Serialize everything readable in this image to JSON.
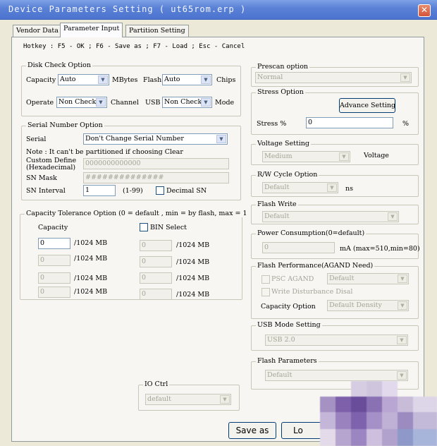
{
  "window": {
    "title": "Device Parameters Setting ( ut65rom.erp )",
    "close_glyph": "✕"
  },
  "tabs": [
    {
      "label": "Vendor Data"
    },
    {
      "label": "Parameter Input"
    },
    {
      "label": "Partition Setting"
    }
  ],
  "hotkey": "Hotkey : F5 - OK ; F6 - Save as ; F7 - Load ; Esc - Cancel",
  "disk_check": {
    "legend": "Disk Check Option",
    "capacity_label": "Capacity",
    "capacity_value": "Auto",
    "mbytes": "MBytes",
    "flash_label": "Flash",
    "flash_value": "Auto",
    "chips": "Chips",
    "operate_label": "Operate",
    "operate_value": "Non Check",
    "channel": "Channel",
    "usb_label": "USB",
    "usb_value": "Non Check",
    "mode": "Mode"
  },
  "serial": {
    "legend": "Serial Number Option",
    "serial_label": "Serial",
    "serial_value": "Don't Change Serial Number",
    "note": "Note : It can't be partitioned if choosing Clear",
    "custom_label_1": "Custom Define",
    "custom_label_2": "(Hexadecimal)",
    "custom_value": "0000000000000",
    "mask_label": "SN Mask",
    "mask_value": "##############",
    "interval_label": "SN Interval",
    "interval_value": "1",
    "interval_range": "(1-99)",
    "decimal_label": "Decimal SN"
  },
  "capacity_tolerance": {
    "legend": "Capacity Tolerance Option (0 = default , min = by flash, max = 1",
    "capacity_label": "Capacity",
    "bin_label": "BIN Select",
    "unit": "/1024 MB",
    "left_values": [
      "0",
      "0",
      "0",
      "0"
    ],
    "right_values": [
      "0",
      "0",
      "0",
      "0"
    ]
  },
  "io_ctrl": {
    "legend": "IO Ctrl",
    "value": "default"
  },
  "prescan": {
    "legend": "Prescan option",
    "value": "Normal"
  },
  "stress": {
    "legend": "Stress Option",
    "advance_button": "Advance Setting",
    "percent_label": "Stress %",
    "percent_value": "0",
    "percent_sign": "%"
  },
  "voltage": {
    "legend": "Voltage Setting",
    "value": "Medium",
    "label": "Voltage"
  },
  "rw_cycle": {
    "legend": "R/W Cycle Option",
    "value": "Default",
    "unit": "ns"
  },
  "flash_write": {
    "legend": "Flash Write",
    "value": "Default"
  },
  "power": {
    "legend": "Power Consumption(0=default)",
    "value": "0",
    "range": "mA (max=510,min=80)"
  },
  "flash_perf": {
    "legend": "Flash Performance(AGAND Need)",
    "psc_label": "PSC AGAND",
    "psc_value": "Default",
    "write_dist_label": "Write Disturbance Disal",
    "capacity_option_label": "Capacity Option",
    "capacity_option_value": "Default Density"
  },
  "usb_mode": {
    "legend": "USB Mode Setting",
    "value": "USB 2.0"
  },
  "flash_params": {
    "legend": "Flash Parameters",
    "value": "Default"
  },
  "buttons": {
    "save_as": "Save as",
    "load": "Lo"
  },
  "colors": {
    "titlebar": "#5b82d6",
    "dialog_bg": "#ece9d8",
    "panel_bg": "#f7f6f3",
    "close": "#d2533a"
  }
}
